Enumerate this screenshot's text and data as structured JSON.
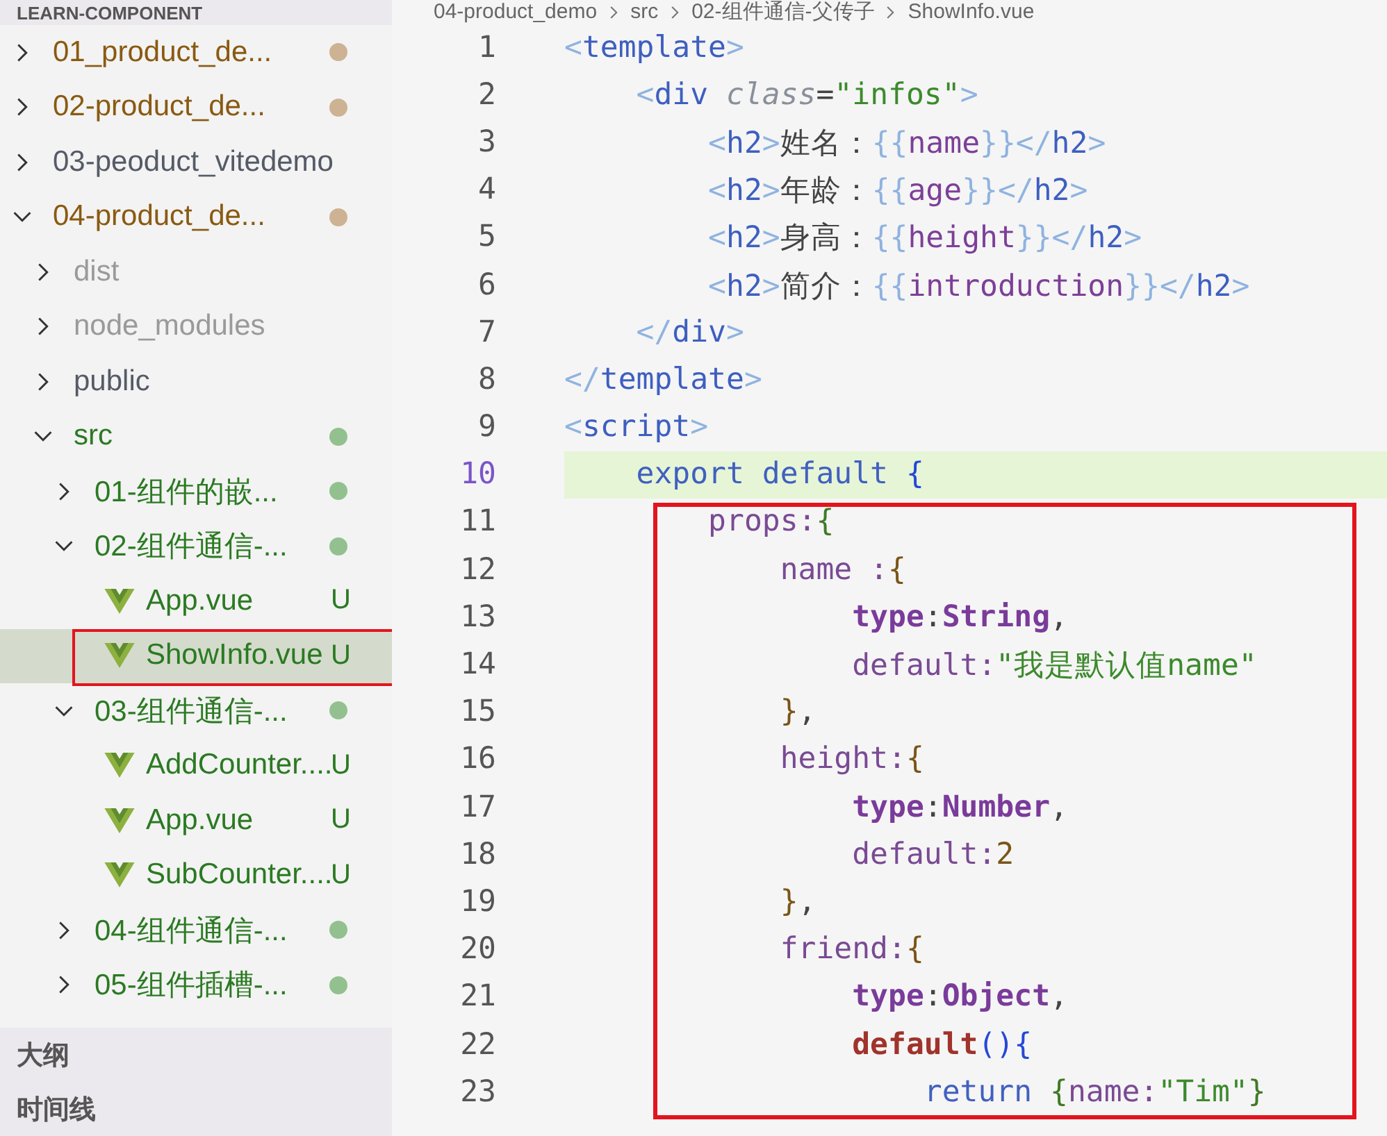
{
  "sidebar": {
    "section_title": "LEARN-COMPONENT",
    "tree": [
      {
        "label": "01_product_de...",
        "kind": "folder",
        "expanded": false,
        "color": "#8a5a12",
        "dot": {
          "color": "#cdb293"
        },
        "framed": false,
        "selected": false
      },
      {
        "label": "02-product_de...",
        "kind": "folder",
        "expanded": false,
        "color": "#8a5a12",
        "dot": {
          "color": "#cdb293"
        },
        "framed": false,
        "selected": false
      },
      {
        "label": "03-peoduct_vitedemo",
        "kind": "folder",
        "expanded": false,
        "color": "#555b66",
        "framed": false,
        "selected": false
      },
      {
        "label": "04-product_de...",
        "kind": "folder",
        "expanded": true,
        "color": "#8a5a12",
        "dot": {
          "color": "#cdb293"
        },
        "framed": false,
        "selected": false,
        "children": [
          {
            "label": "dist",
            "kind": "folder",
            "expanded": false,
            "color": "#9a9a9a",
            "framed": false,
            "selected": false
          },
          {
            "label": "node_modules",
            "kind": "folder",
            "expanded": false,
            "color": "#9a9a9a",
            "framed": false,
            "selected": false
          },
          {
            "label": "public",
            "kind": "folder",
            "expanded": false,
            "color": "#555b66",
            "framed": false,
            "selected": false
          },
          {
            "label": "src",
            "kind": "folder",
            "expanded": true,
            "color": "#2b7a22",
            "dot": {
              "color": "#93c08f"
            },
            "framed": false,
            "selected": false,
            "children": [
              {
                "label": "01-组件的嵌...",
                "kind": "folder",
                "expanded": false,
                "color": "#2b7a22",
                "dot": {
                  "color": "#93c08f"
                },
                "framed": false,
                "selected": false
              },
              {
                "label": "02-组件通信-...",
                "kind": "folder",
                "expanded": true,
                "color": "#2b7a22",
                "dot": {
                  "color": "#93c08f"
                },
                "framed": false,
                "selected": false,
                "children": [
                  {
                    "label": "App.vue",
                    "kind": "vue-file",
                    "color": "#2b7a22",
                    "badge": "U",
                    "framed": false,
                    "selected": false
                  },
                  {
                    "label": "ShowInfo.vue",
                    "kind": "vue-file",
                    "color": "#2b7a22",
                    "badge": "U",
                    "framed": true,
                    "selected": true
                  }
                ]
              },
              {
                "label": "03-组件通信-...",
                "kind": "folder",
                "expanded": true,
                "color": "#2b7a22",
                "dot": {
                  "color": "#93c08f"
                },
                "framed": false,
                "selected": false,
                "children": [
                  {
                    "label": "AddCounter....",
                    "kind": "vue-file",
                    "color": "#2b7a22",
                    "badge": "U",
                    "framed": false,
                    "selected": false
                  },
                  {
                    "label": "App.vue",
                    "kind": "vue-file",
                    "color": "#2b7a22",
                    "badge": "U",
                    "framed": false,
                    "selected": false
                  },
                  {
                    "label": "SubCounter....",
                    "kind": "vue-file",
                    "color": "#2b7a22",
                    "badge": "U",
                    "framed": false,
                    "selected": false
                  }
                ]
              },
              {
                "label": "04-组件通信-...",
                "kind": "folder",
                "expanded": false,
                "color": "#2b7a22",
                "dot": {
                  "color": "#93c08f"
                },
                "framed": false,
                "selected": false
              },
              {
                "label": "05-组件插槽-...",
                "kind": "folder",
                "expanded": false,
                "color": "#2b7a22",
                "dot": {
                  "color": "#93c08f"
                },
                "framed": false,
                "selected": false
              }
            ]
          }
        ]
      }
    ],
    "panels": [
      "大纲",
      "时间线"
    ]
  },
  "editor": {
    "breadcrumb": [
      "04-product_demo",
      "src",
      "02-组件通信-父传子",
      "ShowInfo.vue"
    ],
    "lines": [
      {
        "number": "1",
        "current": false,
        "tokens": [
          {
            "text": "<",
            "kind": "punct"
          },
          {
            "text": "template",
            "kind": "tag"
          },
          {
            "text": ">",
            "kind": "punct"
          }
        ]
      },
      {
        "number": "2",
        "current": false,
        "tokens": [
          {
            "text": "    <",
            "kind": "punct"
          },
          {
            "text": "div",
            "kind": "tag"
          },
          {
            "text": " class",
            "kind": "attr"
          },
          {
            "text": "=",
            "kind": "plain"
          },
          {
            "text": "\"infos\"",
            "kind": "string"
          },
          {
            "text": ">",
            "kind": "punct"
          }
        ]
      },
      {
        "number": "3",
        "current": false,
        "tokens": [
          {
            "text": "        <",
            "kind": "punct"
          },
          {
            "text": "h2",
            "kind": "tag"
          },
          {
            "text": ">",
            "kind": "punct"
          },
          {
            "text": "姓名：",
            "kind": "plain"
          },
          {
            "text": "{{",
            "kind": "punct"
          },
          {
            "text": "name",
            "kind": "var"
          },
          {
            "text": "}}</",
            "kind": "punct"
          },
          {
            "text": "h2",
            "kind": "tag"
          },
          {
            "text": ">",
            "kind": "punct"
          }
        ]
      },
      {
        "number": "4",
        "current": false,
        "tokens": [
          {
            "text": "        <",
            "kind": "punct"
          },
          {
            "text": "h2",
            "kind": "tag"
          },
          {
            "text": ">",
            "kind": "punct"
          },
          {
            "text": "年龄：",
            "kind": "plain"
          },
          {
            "text": "{{",
            "kind": "punct"
          },
          {
            "text": "age",
            "kind": "var"
          },
          {
            "text": "}}</",
            "kind": "punct"
          },
          {
            "text": "h2",
            "kind": "tag"
          },
          {
            "text": ">",
            "kind": "punct"
          }
        ]
      },
      {
        "number": "5",
        "current": false,
        "tokens": [
          {
            "text": "        <",
            "kind": "punct"
          },
          {
            "text": "h2",
            "kind": "tag"
          },
          {
            "text": ">",
            "kind": "punct"
          },
          {
            "text": "身高：",
            "kind": "plain"
          },
          {
            "text": "{{",
            "kind": "punct"
          },
          {
            "text": "height",
            "kind": "var"
          },
          {
            "text": "}}</",
            "kind": "punct"
          },
          {
            "text": "h2",
            "kind": "tag"
          },
          {
            "text": ">",
            "kind": "punct"
          }
        ]
      },
      {
        "number": "6",
        "current": false,
        "tokens": [
          {
            "text": "        <",
            "kind": "punct"
          },
          {
            "text": "h2",
            "kind": "tag"
          },
          {
            "text": ">",
            "kind": "punct"
          },
          {
            "text": "简介：",
            "kind": "plain"
          },
          {
            "text": "{{",
            "kind": "punct"
          },
          {
            "text": "introduction",
            "kind": "var"
          },
          {
            "text": "}}</",
            "kind": "punct"
          },
          {
            "text": "h2",
            "kind": "tag"
          },
          {
            "text": ">",
            "kind": "punct"
          }
        ]
      },
      {
        "number": "7",
        "current": false,
        "tokens": [
          {
            "text": "    </",
            "kind": "punct"
          },
          {
            "text": "div",
            "kind": "tag"
          },
          {
            "text": ">",
            "kind": "punct"
          }
        ]
      },
      {
        "number": "8",
        "current": false,
        "tokens": [
          {
            "text": "</",
            "kind": "punct"
          },
          {
            "text": "template",
            "kind": "tag"
          },
          {
            "text": ">",
            "kind": "punct"
          }
        ]
      },
      {
        "number": "9",
        "current": false,
        "tokens": [
          {
            "text": "<",
            "kind": "punct"
          },
          {
            "text": "script",
            "kind": "tag"
          },
          {
            "text": ">",
            "kind": "punct"
          }
        ]
      },
      {
        "number": "10",
        "current": true,
        "tokens": [
          {
            "text": "    export default ",
            "kind": "keyword"
          },
          {
            "text": "{",
            "kind": "brace-blue"
          }
        ]
      }
    ],
    "highlight_frame": {
      "lines": [
        {
          "number": "11",
          "current": false,
          "tokens": [
            {
              "text": "        props:",
              "kind": "prop"
            },
            {
              "text": "{",
              "kind": "brace-green"
            }
          ]
        },
        {
          "number": "12",
          "current": false,
          "tokens": [
            {
              "text": "            name :",
              "kind": "prop"
            },
            {
              "text": "{",
              "kind": "brace-brown"
            }
          ]
        },
        {
          "number": "13",
          "current": false,
          "tokens": [
            {
              "text": "                type",
              "kind": "type"
            },
            {
              "text": ":",
              "kind": "plain"
            },
            {
              "text": "String",
              "kind": "type"
            },
            {
              "text": ",",
              "kind": "plain"
            }
          ]
        },
        {
          "number": "14",
          "current": false,
          "tokens": [
            {
              "text": "                default:",
              "kind": "prop"
            },
            {
              "text": "\"我是默认值name\"",
              "kind": "string"
            }
          ]
        },
        {
          "number": "15",
          "current": false,
          "tokens": [
            {
              "text": "            }",
              "kind": "brace-brown"
            },
            {
              "text": ",",
              "kind": "plain"
            }
          ]
        },
        {
          "number": "16",
          "current": false,
          "tokens": [
            {
              "text": "            height:",
              "kind": "prop"
            },
            {
              "text": "{",
              "kind": "brace-brown"
            }
          ]
        },
        {
          "number": "17",
          "current": false,
          "tokens": [
            {
              "text": "                type",
              "kind": "type"
            },
            {
              "text": ":",
              "kind": "plain"
            },
            {
              "text": "Number",
              "kind": "type"
            },
            {
              "text": ",",
              "kind": "plain"
            }
          ]
        },
        {
          "number": "18",
          "current": false,
          "tokens": [
            {
              "text": "                default:",
              "kind": "prop"
            },
            {
              "text": "2",
              "kind": "number"
            }
          ]
        },
        {
          "number": "19",
          "current": false,
          "tokens": [
            {
              "text": "            }",
              "kind": "brace-brown"
            },
            {
              "text": ",",
              "kind": "plain"
            }
          ]
        },
        {
          "number": "20",
          "current": false,
          "tokens": [
            {
              "text": "            friend:",
              "kind": "prop"
            },
            {
              "text": "{",
              "kind": "brace-brown"
            }
          ]
        },
        {
          "number": "21",
          "current": false,
          "tokens": [
            {
              "text": "                type",
              "kind": "type"
            },
            {
              "text": ":",
              "kind": "plain"
            },
            {
              "text": "Object",
              "kind": "type"
            },
            {
              "text": ",",
              "kind": "plain"
            }
          ]
        },
        {
          "number": "22",
          "current": false,
          "tokens": [
            {
              "text": "                default",
              "kind": "func"
            },
            {
              "text": "()",
              "kind": "brace-blue"
            },
            {
              "text": "{",
              "kind": "brace-blue"
            }
          ]
        },
        {
          "number": "23",
          "current": false,
          "tokens": [
            {
              "text": "                    return ",
              "kind": "keyword"
            },
            {
              "text": "{",
              "kind": "brace-green"
            },
            {
              "text": "name:",
              "kind": "prop"
            },
            {
              "text": "\"Tim\"",
              "kind": "string"
            },
            {
              "text": "}",
              "kind": "brace-green"
            }
          ]
        }
      ]
    }
  }
}
